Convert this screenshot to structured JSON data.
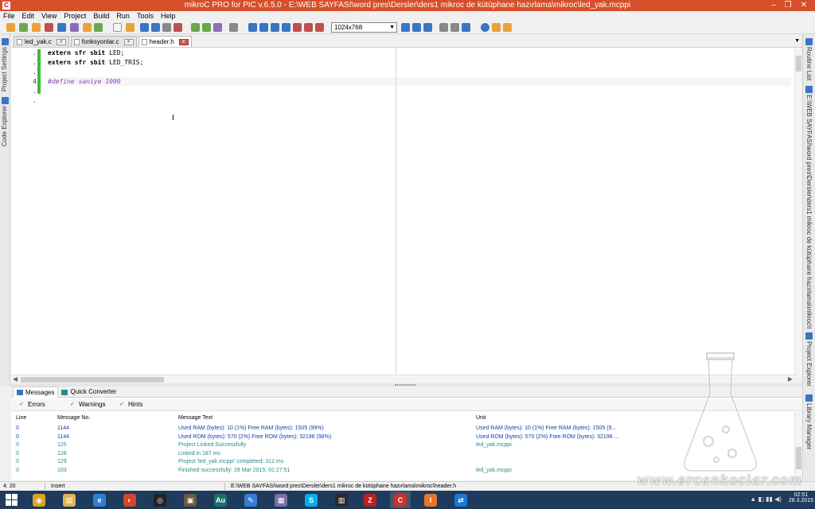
{
  "window": {
    "title": "mikroC PRO for PIC v.6.5.0 - E:\\WEB SAYFASI\\word pres\\Dersler\\ders1 mikroc de kütüphane hazırlama\\mikroc\\led_yak.mcppi",
    "minimize": "–",
    "maximize": "❐",
    "close": "✕"
  },
  "menu": [
    "File",
    "Edit",
    "View",
    "Project",
    "Build",
    "Run",
    "Tools",
    "Help"
  ],
  "toolbar": {
    "zoom_value": "1024x768",
    "icon_colors": [
      "#e8a33a",
      "#6aa84f",
      "#3a75c4",
      "#c0504d",
      "#8a6fb8"
    ]
  },
  "left_panel": {
    "tabs": [
      "Project Settings",
      "Code Explorer"
    ]
  },
  "right_panel": {
    "tabs": [
      "Routine List",
      "E:\\WEB SAYFASI\\word pres\\Dersler\\ders1 mikroc de kütüphane hazırlama\\mikroc\\led_yak.mcppi",
      "Project Explorer",
      "Library Manager"
    ]
  },
  "doc_tabs": [
    {
      "label": "led_yak.c",
      "active": false
    },
    {
      "label": "fonksyonlar.c",
      "active": false
    },
    {
      "label": "header.h",
      "active": true
    }
  ],
  "editor": {
    "line_numbers": [
      ".",
      ".",
      ".",
      "4",
      ".",
      "."
    ],
    "lines": [
      {
        "kw": "extern sfr sbit",
        "rest": " LED;",
        "pp": false
      },
      {
        "kw": "extern sfr sbit",
        "rest": " LED_TRIS;",
        "pp": false
      },
      {
        "kw": "",
        "rest": "",
        "pp": false
      },
      {
        "kw": "",
        "rest": "#define saniye 1000",
        "pp": true
      }
    ]
  },
  "bottom_panel": {
    "tabs": [
      "Messages",
      "Quick Converter"
    ],
    "filters": [
      "Errors",
      "Warnings",
      "Hints"
    ],
    "columns": {
      "line": "Line",
      "no": "Message No.",
      "text": "Message Text",
      "unit": "Unit"
    },
    "rows": [
      {
        "line": "0",
        "no": "1144",
        "text": "Used RAM (bytes): 10 (1%)  Free RAM (bytes): 1505 (99%)",
        "unit": "Used RAM (bytes): 10 (1%)  Free RAM (bytes): 1505 (9...",
        "kind": "info"
      },
      {
        "line": "0",
        "no": "1144",
        "text": "Used ROM (bytes): 570 (2%)  Free ROM (bytes): 32198 (98%)",
        "unit": "Used ROM (bytes): 570 (2%)  Free ROM (bytes): 32198 ...",
        "kind": "info"
      },
      {
        "line": "0",
        "no": "125",
        "text": "Project Linked Successfully",
        "unit": "led_yak.mcppi",
        "kind": "hint"
      },
      {
        "line": "0",
        "no": "128",
        "text": "Linked in 187 ms",
        "unit": "",
        "kind": "hint"
      },
      {
        "line": "0",
        "no": "129",
        "text": "Project 'led_yak.mcppi' completed: 312 ms",
        "unit": "",
        "kind": "hint"
      },
      {
        "line": "0",
        "no": "103",
        "text": "Finished successfully: 28 Mar 2015, 01:27:51",
        "unit": "led_yak.mcppi",
        "kind": "hint"
      }
    ]
  },
  "statusbar": {
    "position": "4: 20",
    "mode": "Insert",
    "path": "E:\\WEB SAYFASI\\word pres\\Dersler\\ders1 mikroc de kütüphane hazırlama\\mikroc\\header.h"
  },
  "taskbar": {
    "apps": [
      {
        "name": "chrome",
        "color": "#d9a521",
        "glyph": "◉"
      },
      {
        "name": "file-explorer",
        "color": "#e3b54a",
        "glyph": "▤"
      },
      {
        "name": "internet-explorer",
        "color": "#2f7fd1",
        "glyph": "e"
      },
      {
        "name": "recorder",
        "color": "#d6452a",
        "glyph": "◐"
      },
      {
        "name": "obs",
        "color": "#222222",
        "glyph": "◎"
      },
      {
        "name": "utility",
        "color": "#6c5a3c",
        "glyph": "▣"
      },
      {
        "name": "audition",
        "color": "#1d6e6a",
        "glyph": "Au"
      },
      {
        "name": "notepad",
        "color": "#3a7bd5",
        "glyph": "✎"
      },
      {
        "name": "viewer",
        "color": "#7a6fa8",
        "glyph": "▦"
      },
      {
        "name": "skype",
        "color": "#00aff0",
        "glyph": "S"
      },
      {
        "name": "chip",
        "color": "#2a2a2a",
        "glyph": "▥"
      },
      {
        "name": "filezilla",
        "color": "#bf1e1e",
        "glyph": "Z"
      },
      {
        "name": "mikroc",
        "color": "#c9302c",
        "glyph": "C"
      },
      {
        "name": "installer",
        "color": "#e8742a",
        "glyph": "I"
      },
      {
        "name": "teamviewer",
        "color": "#1d76cf",
        "glyph": "⇄"
      }
    ],
    "time": "02:51",
    "date": "28.3.2015"
  },
  "watermark": {
    "text": "www.ercankoclar.com"
  }
}
